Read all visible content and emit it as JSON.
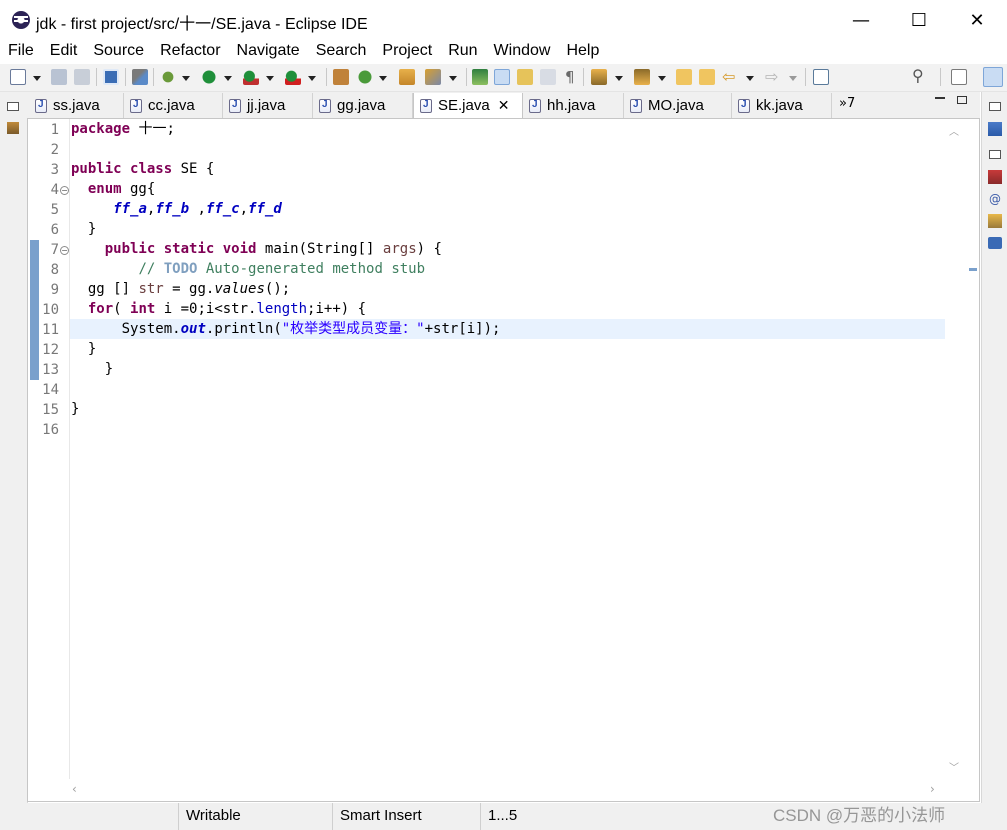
{
  "window": {
    "title": "jdk - first project/src/十一/SE.java - Eclipse IDE",
    "minimize_glyph": "—",
    "maximize_glyph": "☐",
    "close_glyph": "✕"
  },
  "menu": [
    "File",
    "Edit",
    "Source",
    "Refactor",
    "Navigate",
    "Search",
    "Project",
    "Run",
    "Window",
    "Help"
  ],
  "tabs": [
    {
      "label": "ss.java",
      "active": false
    },
    {
      "label": "cc.java",
      "active": false
    },
    {
      "label": "jj.java",
      "active": false
    },
    {
      "label": "gg.java",
      "active": false
    },
    {
      "label": "SE.java",
      "active": true
    },
    {
      "label": "hh.java",
      "active": false
    },
    {
      "label": "MO.java",
      "active": false
    },
    {
      "label": "kk.java",
      "active": false
    }
  ],
  "tab_overflow": "»7",
  "active_tab_close": "✕",
  "editor": {
    "line_numbers": [
      "1",
      "2",
      "3",
      "4",
      "5",
      "6",
      "7",
      "8",
      "9",
      "10",
      "11",
      "12",
      "13",
      "14",
      "15",
      "16"
    ],
    "code": {
      "l1_kw": "package",
      "l1_rest": " 十一;",
      "l3_kw1": "public",
      "l3_kw2": "class",
      "l3_rest": " SE {",
      "l4_kw": "enum",
      "l4_rest": " gg{",
      "l5_c1": "ff_a",
      "l5_s1": ",",
      "l5_c2": "ff_b",
      "l5_s2": " ,",
      "l5_c3": "ff_c",
      "l5_s3": ",",
      "l5_c4": "ff_d",
      "l6": "}",
      "l7_kw1": "public",
      "l7_kw2": "static",
      "l7_kw3": "void",
      "l7_rest1": " main(String[] ",
      "l7_param": "args",
      "l7_rest2": ") {",
      "l8_slashes": "// ",
      "l8_todo": "TODO",
      "l8_rest": " Auto-generated method stub",
      "l9_a": "gg [] ",
      "l9_var": "str",
      "l9_b": " = gg.",
      "l9_call": "values",
      "l9_c": "();",
      "l10_kw1": "for",
      "l10_a": "( ",
      "l10_kw2": "int",
      "l10_b": " i =0;i<str.",
      "l10_field": "length",
      "l10_c": ";i++) {",
      "l11_a": "System.",
      "l11_field": "out",
      "l11_b": ".println(",
      "l11_str": "\"枚举类型成员变量：\"",
      "l11_c": "+str[i]);",
      "l12": "}",
      "l13": "}",
      "l15": "}"
    }
  },
  "status": {
    "writable": "Writable",
    "insert_mode": "Smart Insert",
    "position": "1...5"
  },
  "watermark": "CSDN @万恶的小法师"
}
